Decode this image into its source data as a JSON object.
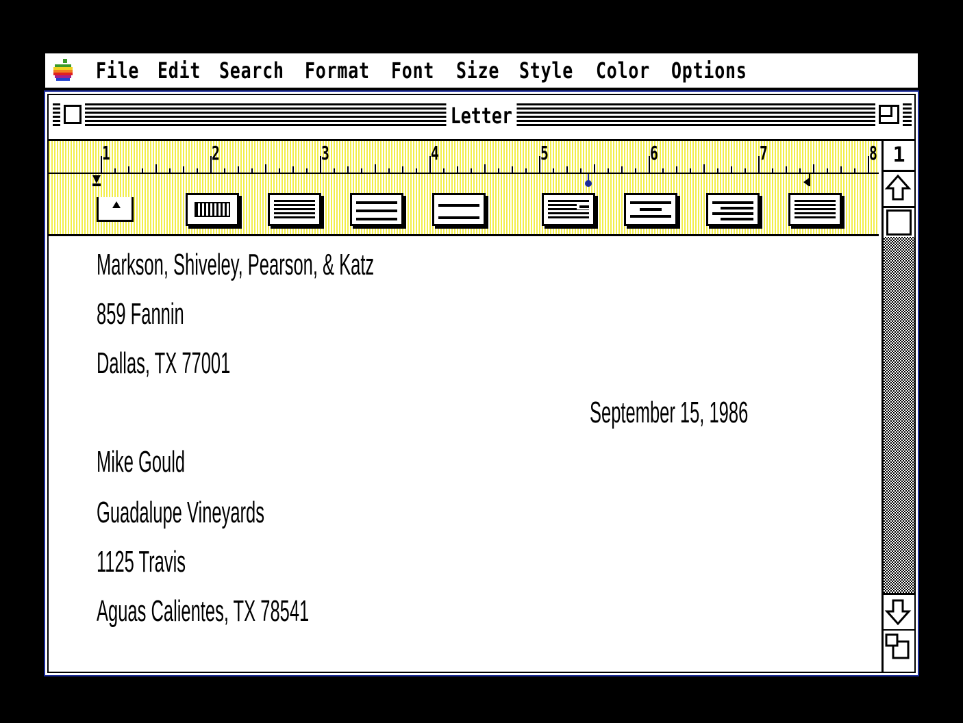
{
  "menubar": {
    "items": [
      "File",
      "Edit",
      "Search",
      "Format",
      "Font",
      "Size",
      "Style",
      "Color",
      "Options"
    ]
  },
  "window": {
    "title": "Letter"
  },
  "ruler": {
    "numbers": [
      "1",
      "2",
      "3",
      "4",
      "5",
      "6",
      "7",
      "8"
    ]
  },
  "scrollbar": {
    "page_number": "1"
  },
  "document": {
    "sender_name": "Markson, Shiveley, Pearson, & Katz",
    "sender_street": "859 Fannin",
    "sender_city": "Dallas, TX 77001",
    "date": "September 15, 1986",
    "recipient_name": "Mike Gould",
    "recipient_company": "Guadalupe Vineyards",
    "recipient_street": "1125 Travis",
    "recipient_city": "Aguas Calientes, TX 78541"
  },
  "colors": {
    "ruler_yellow": "#f2ee4a",
    "window_border": "#1a2a9a",
    "apple_logo": [
      "#3a9a2a",
      "#f0d020",
      "#f08020",
      "#e02020",
      "#a02090",
      "#2040d0"
    ]
  },
  "icons": [
    "apple-menu-icon",
    "close-box-icon",
    "zoom-box-icon",
    "scroll-up-arrow-icon",
    "scroll-down-arrow-icon",
    "size-box-icon"
  ]
}
